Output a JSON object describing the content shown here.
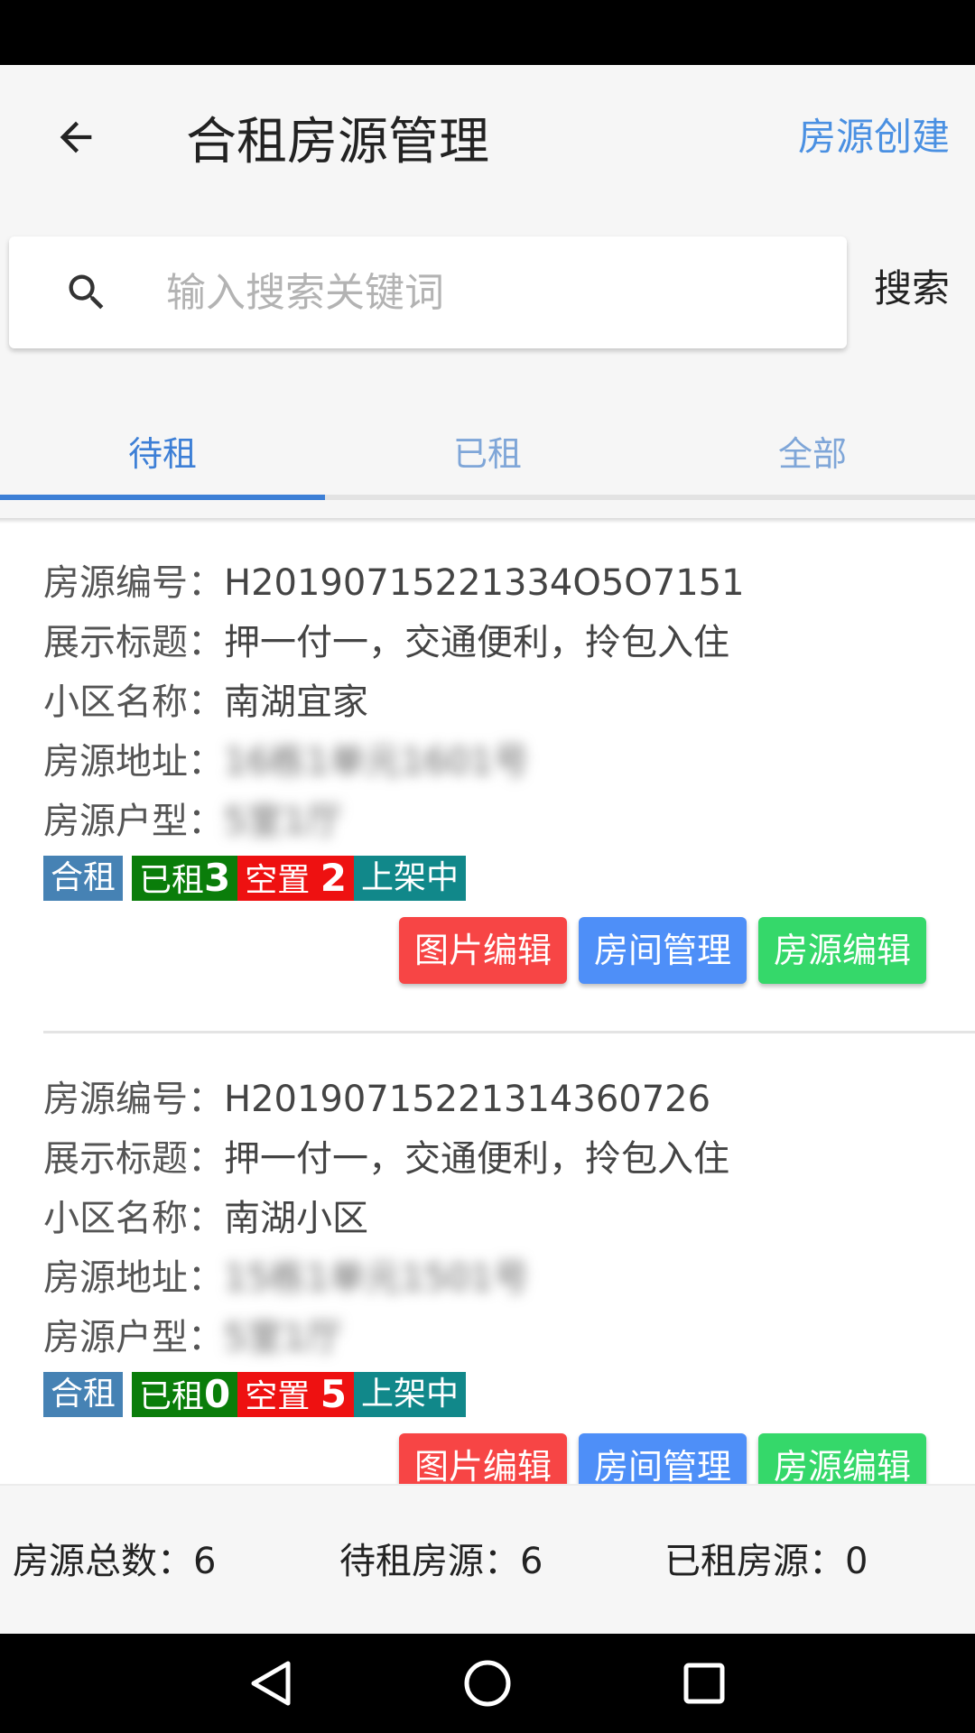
{
  "header": {
    "title": "合租房源管理",
    "create_label": "房源创建",
    "back_icon": "arrow-left-icon"
  },
  "search": {
    "placeholder": "输入搜索关键词",
    "button_label": "搜索",
    "icon": "search-icon"
  },
  "tabs": [
    {
      "label": "待租",
      "active": true
    },
    {
      "label": "已租",
      "active": false
    },
    {
      "label": "全部",
      "active": false
    }
  ],
  "labels": {
    "code": "房源编号：",
    "title": "展示标题：",
    "community": "小区名称：",
    "address": "房源地址：",
    "layout": "房源户型："
  },
  "listings": [
    {
      "code": "H20190715221334O5O7151",
      "title": "押一付一，交通便利，拎包入住",
      "community": "南湖宜家",
      "address": "16栋1单元1601号",
      "layout": "5室1厅",
      "tag_type": "合租",
      "rented_label": "已租",
      "rented_count": "3",
      "vacant_label": "空置",
      "vacant_count": "2",
      "status": "上架中",
      "buttons": {
        "photo": "图片编辑",
        "rooms": "房间管理",
        "edit": "房源编辑"
      }
    },
    {
      "code": "H20190715221314360726",
      "title": "押一付一，交通便利，拎包入住",
      "community": "南湖小区",
      "address": "15栋1单元1501号",
      "layout": "5室1厅",
      "tag_type": "合租",
      "rented_label": "已租",
      "rented_count": "0",
      "vacant_label": "空置",
      "vacant_count": "5",
      "status": "上架中",
      "buttons": {
        "photo": "图片编辑",
        "rooms": "房间管理",
        "edit": "房源编辑"
      }
    }
  ],
  "footer": {
    "total": "房源总数：6",
    "pending": "待租房源：6",
    "rented": "已租房源：0"
  },
  "nav": {
    "back": "nav-back-icon",
    "home": "nav-home-icon",
    "recents": "nav-recents-icon"
  },
  "colors": {
    "accent": "#3d7fd6",
    "tag_type": "#4682b4",
    "tag_rented": "#0a7d0a",
    "tag_vacant": "#ee1111",
    "tag_listed": "#11888a",
    "btn_red": "#f74545",
    "btn_blue": "#4e8ff8",
    "btn_green": "#35d86a"
  }
}
